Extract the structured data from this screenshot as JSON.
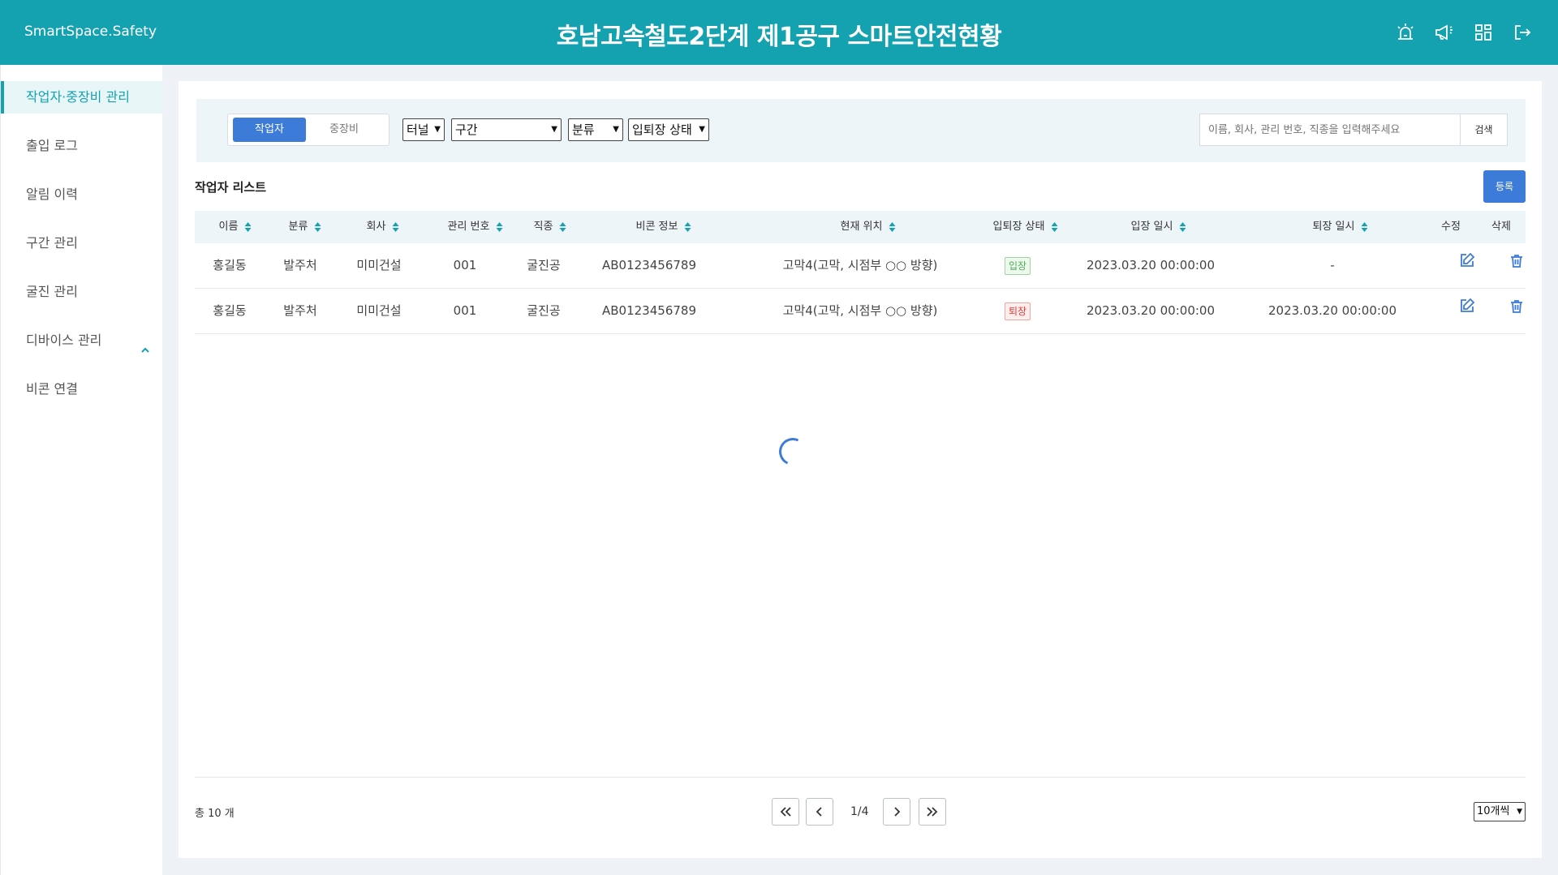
{
  "header": {
    "brand": "SmartSpace.Safety",
    "title": "호남고속철도2단계 제1공구 스마트안전현황",
    "icons": [
      "alarm-icon",
      "megaphone-icon",
      "dashboard-icon",
      "logout-icon"
    ]
  },
  "sidebar": {
    "items": [
      {
        "label": "작업자·중장비 관리",
        "active": true
      },
      {
        "label": "출입 로그"
      },
      {
        "label": "알림 이력"
      },
      {
        "label": "구간 관리"
      },
      {
        "label": "굴진 관리"
      },
      {
        "label": "디바이스 관리",
        "expandable": true
      },
      {
        "label": "비콘 연결"
      }
    ]
  },
  "filters": {
    "tabs": {
      "worker": "작업자",
      "equipment": "중장비",
      "selected": "작업자"
    },
    "selects": {
      "tunnel": "터널",
      "section": "구간",
      "category": "분류",
      "status": "입퇴장 상태"
    },
    "search": {
      "placeholder": "이름, 회사, 관리 번호, 직종을 입력해주세요",
      "button": "검색"
    }
  },
  "list": {
    "title": "작업자 리스트",
    "register_button": "등록",
    "columns": [
      "이름",
      "분류",
      "회사",
      "관리 번호",
      "직종",
      "비콘 정보",
      "현재 위치",
      "입퇴장 상태",
      "입장 일시",
      "퇴장 일시",
      "수정",
      "삭제"
    ],
    "rows": [
      {
        "name": "홍길동",
        "category": "발주처",
        "company": "미미건설",
        "mgmt_no": "001",
        "job": "굴진공",
        "beacon": "AB0123456789",
        "location": "고막4(고막, 시점부 ○○ 방향)",
        "status": "입장",
        "entry_time": "2023.03.20 00:00:00",
        "exit_time": "-"
      },
      {
        "name": "홍길동",
        "category": "발주처",
        "company": "미미건설",
        "mgmt_no": "001",
        "job": "굴진공",
        "beacon": "AB0123456789",
        "location": "고막4(고막, 시점부 ○○ 방향)",
        "status": "퇴장",
        "entry_time": "2023.03.20 00:00:00",
        "exit_time": "2023.03.20 00:00:00"
      }
    ]
  },
  "pagination": {
    "total": "총 10 개",
    "page": "1/4",
    "per_page": "10개씩"
  },
  "colors": {
    "header": "#14a1b0",
    "primary": "#3d7bd9",
    "status_in": "#4caf50",
    "status_out": "#e53935"
  }
}
